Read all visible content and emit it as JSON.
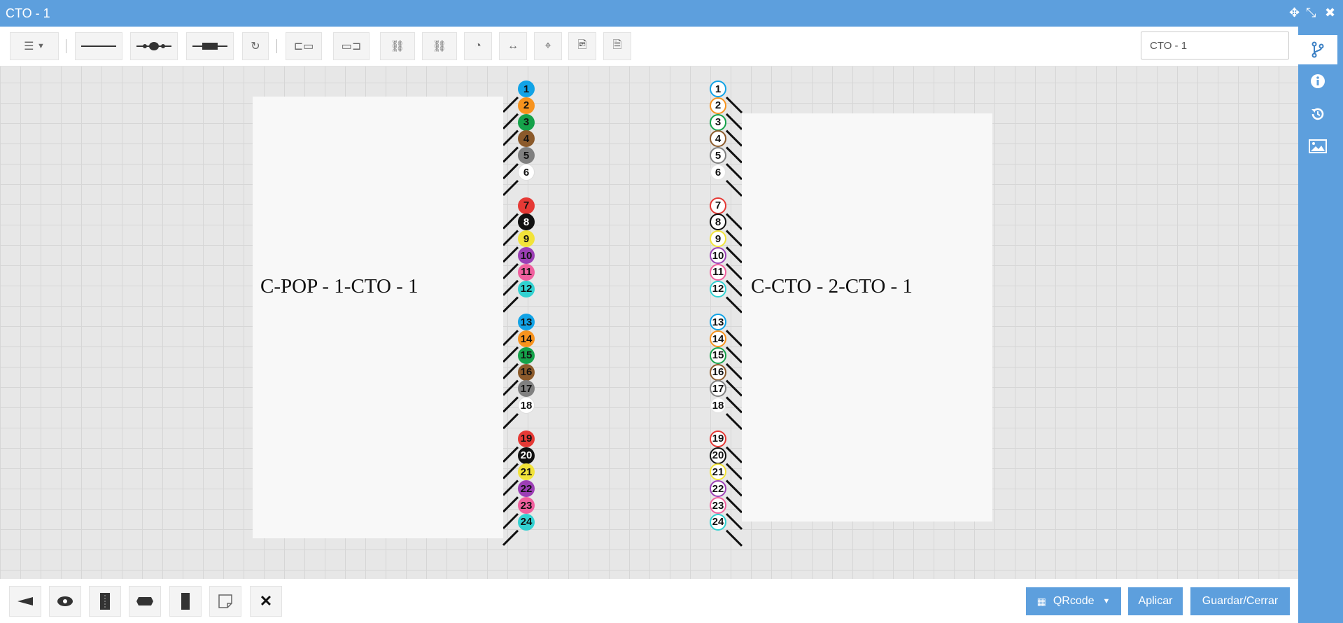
{
  "window": {
    "title": "CTO - 1",
    "name_input_value": "CTO - 1"
  },
  "colors": {
    "titlebar": "#5d9fdd",
    "canvas": "#e7e7e7"
  },
  "toolbar": {
    "icons": [
      "list-menu-icon",
      "straight-line-icon",
      "splice-connector-icon",
      "splitter-connector-icon",
      "refresh-icon",
      "light-source-icon",
      "power-meter-icon",
      "connect-fibers-icon",
      "disconnect-fibers-icon",
      "gauge-icon",
      "expand-horizontal-icon",
      "center-view-icon",
      "export-image-icon",
      "export-pdf-icon"
    ]
  },
  "cables": {
    "left": {
      "label": "C-POP - 1-CTO - 1",
      "fibers": [
        "1",
        "2",
        "3",
        "4",
        "5",
        "6",
        "7",
        "8",
        "9",
        "10",
        "11",
        "12",
        "13",
        "14",
        "15",
        "16",
        "17",
        "18",
        "19",
        "20",
        "21",
        "22",
        "23",
        "24"
      ]
    },
    "right": {
      "label": "C-CTO - 2-CTO - 1",
      "fibers": [
        "1",
        "2",
        "3",
        "4",
        "5",
        "6",
        "7",
        "8",
        "9",
        "10",
        "11",
        "12",
        "13",
        "14",
        "15",
        "16",
        "17",
        "18",
        "19",
        "20",
        "21",
        "22",
        "23",
        "24"
      ]
    }
  },
  "fiber_colors": [
    "#12a3e6",
    "#f7931e",
    "#15a24a",
    "#8b5a2b",
    "#808080",
    "#ffffff",
    "#e53935",
    "#111111",
    "#f2e33a",
    "#9c3fb5",
    "#f0609e",
    "#32d1d1"
  ],
  "bottom": {
    "tools": [
      "splitter-tool-icon",
      "splice-box-tool-icon",
      "rack-tool-icon",
      "connector-tool-icon",
      "odf-tool-icon",
      "note-tool-icon",
      "delete-icon"
    ],
    "qrcode_label": "QRcode",
    "apply_label": "Aplicar",
    "save_close_label": "Guardar/Cerrar"
  },
  "sidebar": {
    "tabs": [
      "connections-icon",
      "info-icon",
      "history-icon",
      "image-icon"
    ]
  }
}
